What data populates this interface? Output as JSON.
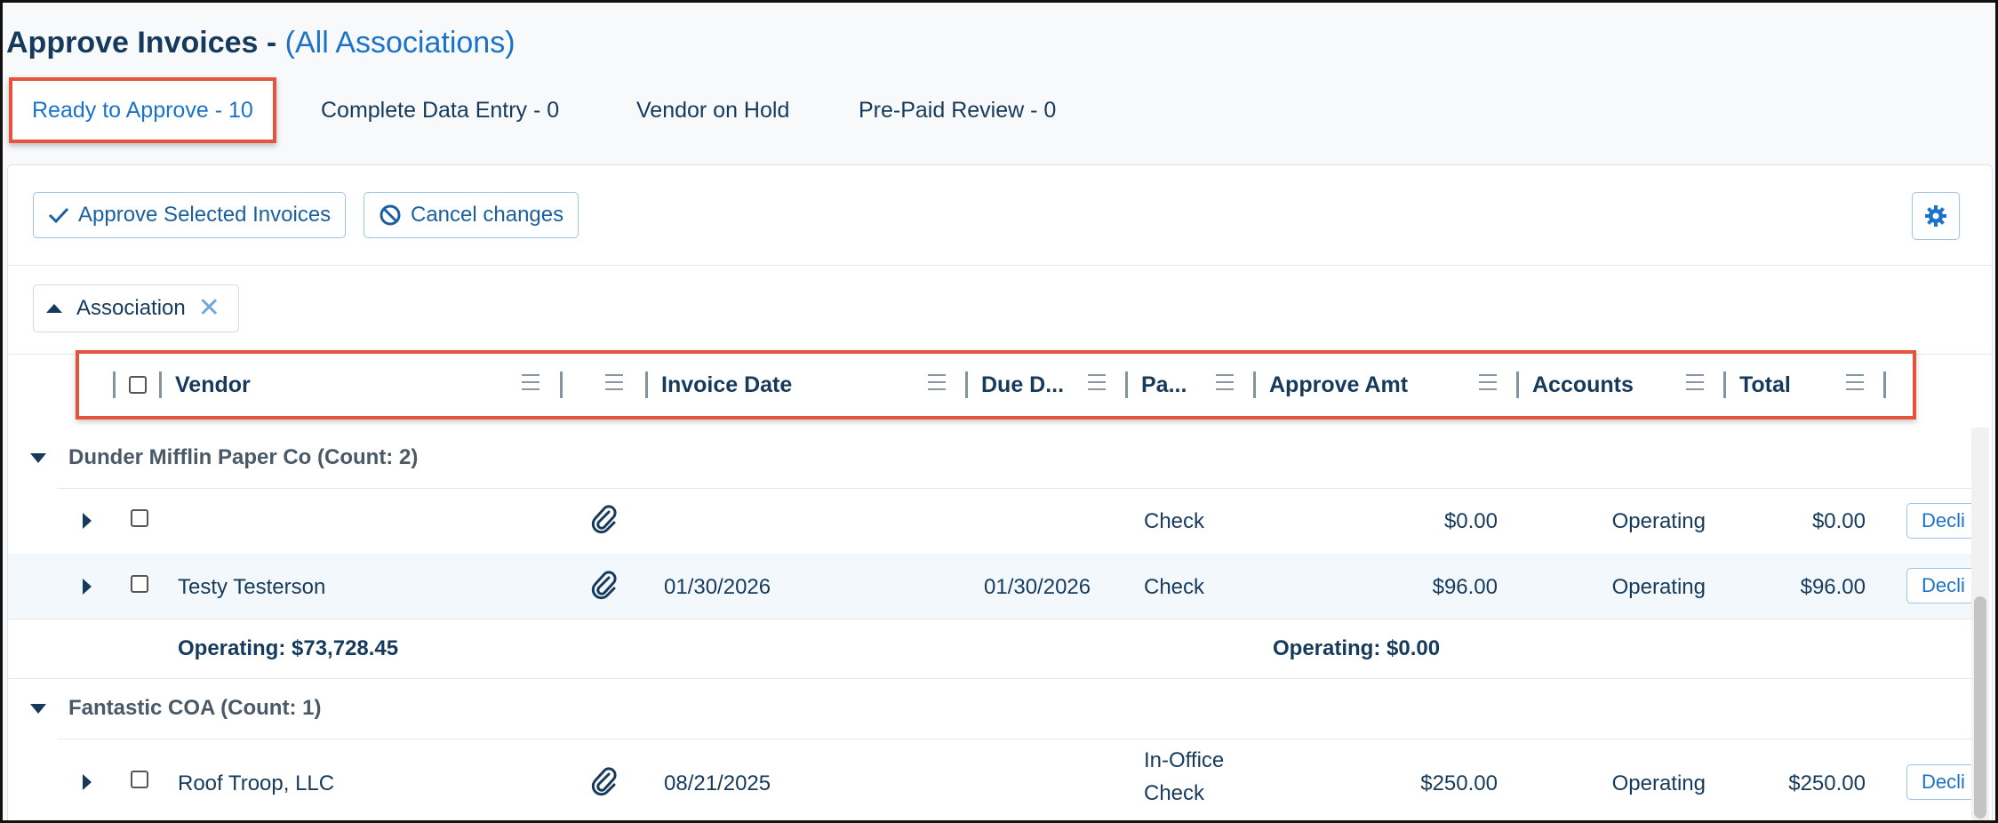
{
  "page": {
    "title": "Approve Invoices -",
    "scope": "(All Associations)"
  },
  "tabs": [
    {
      "label": "Ready to Approve - 10",
      "active": true
    },
    {
      "label": "Complete Data Entry - 0"
    },
    {
      "label": "Vendor on Hold"
    },
    {
      "label": "Pre-Paid Review - 0"
    }
  ],
  "toolbar": {
    "approve_label": "Approve Selected Invoices",
    "cancel_label": "Cancel changes",
    "settings_icon": "gear-icon"
  },
  "grouping": {
    "chip_label": "Association"
  },
  "columns": {
    "vendor": "Vendor",
    "invoice_date": "Invoice Date",
    "due_date": "Due D...",
    "pay": "Pa...",
    "approve_amt": "Approve Amt",
    "accounts": "Accounts",
    "total": "Total"
  },
  "groups": [
    {
      "title": "Dunder Mifflin Paper Co (Count: 2)",
      "rows": [
        {
          "vendor": "",
          "invoice_date": "",
          "due_date": "",
          "pay": "Check",
          "approve_amt": "$0.00",
          "accounts": "Operating",
          "total": "$0.00",
          "action": "Decli"
        },
        {
          "vendor": "Testy Testerson",
          "invoice_date": "01/30/2026",
          "due_date": "01/30/2026",
          "pay": "Check",
          "approve_amt": "$96.00",
          "accounts": "Operating",
          "total": "$96.00",
          "action": "Decli"
        }
      ],
      "subtotal_left": "Operating: $73,728.45",
      "subtotal_right": "Operating: $0.00"
    },
    {
      "title": "Fantastic COA (Count: 1)",
      "rows": [
        {
          "vendor": "Roof Troop, LLC",
          "invoice_date": "08/21/2025",
          "due_date": "",
          "pay_line1": "In-Office",
          "pay_line2": "Check",
          "approve_amt": "$250.00",
          "accounts": "Operating",
          "total": "$250.00",
          "action": "Decli"
        }
      ]
    }
  ],
  "colors": {
    "accent": "#1a73c9",
    "navy": "#163a5c",
    "highlight": "#e5533d"
  }
}
